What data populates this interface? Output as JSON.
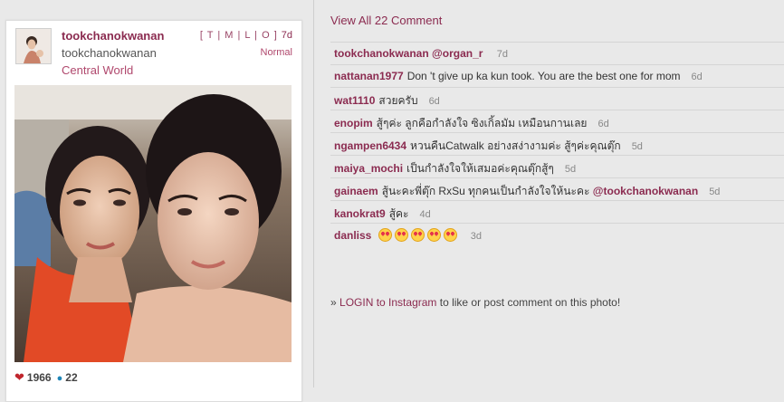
{
  "post": {
    "username": "tookchanokwanan",
    "fullname": "tookchanokwanan",
    "location": "Central World",
    "tmlo": "[ T | M | L | O ]",
    "age": "7d",
    "filter": "Normal",
    "likes": "1966",
    "comments_count": "22"
  },
  "icons": {
    "like": "heart-icon",
    "comment": "speech-bubble-icon",
    "emoji": "heart-eyes-emoji"
  },
  "colors": {
    "accent": "#8b2b50",
    "heart": "#c0262d",
    "bubble": "#1f86b8"
  },
  "view_all": "View All 22 Comment",
  "comments": [
    {
      "user": "tookchanokwanan",
      "text": "",
      "mention": "@organ_r",
      "age": "7d"
    },
    {
      "user": "nattanan1977",
      "text": "Don 't give up ka kun took. You are the best one for mom",
      "mention": "",
      "age": "6d"
    },
    {
      "user": "wat1110",
      "text": "สวยครับ",
      "mention": "",
      "age": "6d"
    },
    {
      "user": "enopim",
      "text": "สู้ๆค่ะ ลูกคือกำลังใจ ซิงเกิ้ลมัม เหมือนกานเลย",
      "mention": "",
      "age": "6d"
    },
    {
      "user": "ngampen6434",
      "text": "หวนคืนCatwalk อย่างสง่างามค่ะ สู้ๆค่ะคุณตุ๊ก",
      "mention": "",
      "age": "5d"
    },
    {
      "user": "maiya_mochi",
      "text": "เป็นกำลังใจให้เสมอค่ะคุณตุ๊กสู้ๆ",
      "mention": "",
      "age": "5d"
    },
    {
      "user": "gainaem",
      "text": "สู้นะคะพี่ตุ๊ก RxSu ทุกคนเป็นกำลังใจให้นะคะ",
      "mention": "@tookchanokwanan",
      "age": "5d"
    },
    {
      "user": "kanokrat9",
      "text": "สู้คะ",
      "mention": "",
      "age": "4d"
    },
    {
      "user": "danliss",
      "text": "",
      "mention": "",
      "emoji_count": 5,
      "age": "3d"
    }
  ],
  "login": {
    "prefix": "»",
    "link": "LOGIN to Instagram",
    "suffix": "to like or post comment on this photo!"
  }
}
